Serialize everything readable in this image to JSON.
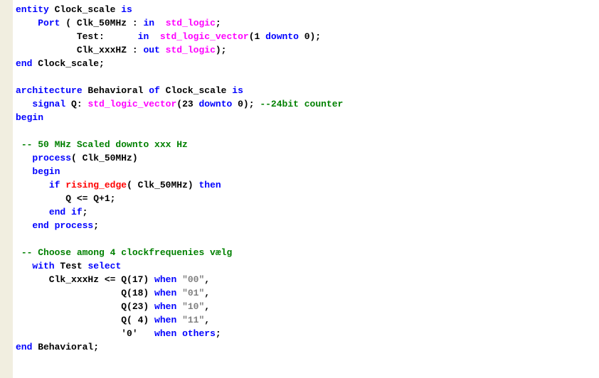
{
  "lines": [
    {
      "segments": [
        {
          "t": "entity",
          "c": "kw"
        },
        {
          "t": " Clock_scale "
        },
        {
          "t": "is",
          "c": "kw"
        }
      ]
    },
    {
      "segments": [
        {
          "t": "    "
        },
        {
          "t": "Port",
          "c": "kw"
        },
        {
          "t": " ( Clk_50MHz : "
        },
        {
          "t": "in",
          "c": "kw"
        },
        {
          "t": "  "
        },
        {
          "t": "std_logic",
          "c": "type"
        },
        {
          "t": ";"
        }
      ]
    },
    {
      "segments": [
        {
          "t": "           Test:      "
        },
        {
          "t": "in",
          "c": "kw"
        },
        {
          "t": "  "
        },
        {
          "t": "std_logic_vector",
          "c": "type"
        },
        {
          "t": "(1 "
        },
        {
          "t": "downto",
          "c": "kw"
        },
        {
          "t": " 0);"
        }
      ]
    },
    {
      "segments": [
        {
          "t": "           Clk_xxxHZ : "
        },
        {
          "t": "out",
          "c": "kw"
        },
        {
          "t": " "
        },
        {
          "t": "std_logic",
          "c": "type"
        },
        {
          "t": ");"
        }
      ]
    },
    {
      "segments": [
        {
          "t": "end",
          "c": "kw"
        },
        {
          "t": " Clock_scale;"
        }
      ]
    },
    {
      "segments": [
        {
          "t": ""
        }
      ]
    },
    {
      "segments": [
        {
          "t": "architecture",
          "c": "kw"
        },
        {
          "t": " Behavioral "
        },
        {
          "t": "of",
          "c": "kw"
        },
        {
          "t": " Clock_scale "
        },
        {
          "t": "is",
          "c": "kw"
        }
      ]
    },
    {
      "segments": [
        {
          "t": "   "
        },
        {
          "t": "signal",
          "c": "kw"
        },
        {
          "t": " Q: "
        },
        {
          "t": "std_logic_vector",
          "c": "type"
        },
        {
          "t": "(23 "
        },
        {
          "t": "downto",
          "c": "kw"
        },
        {
          "t": " 0); "
        },
        {
          "t": "--24bit counter",
          "c": "comment"
        }
      ]
    },
    {
      "segments": [
        {
          "t": "begin",
          "c": "kw"
        }
      ]
    },
    {
      "segments": [
        {
          "t": ""
        }
      ]
    },
    {
      "segments": [
        {
          "t": " "
        },
        {
          "t": "-- 50 MHz Scaled downto xxx Hz",
          "c": "comment"
        }
      ]
    },
    {
      "segments": [
        {
          "t": "   "
        },
        {
          "t": "process",
          "c": "kw"
        },
        {
          "t": "( Clk_50MHz)"
        }
      ]
    },
    {
      "segments": [
        {
          "t": "   "
        },
        {
          "t": "begin",
          "c": "kw"
        }
      ]
    },
    {
      "segments": [
        {
          "t": "      "
        },
        {
          "t": "if",
          "c": "kw"
        },
        {
          "t": " "
        },
        {
          "t": "rising_edge",
          "c": "fn"
        },
        {
          "t": "( Clk_50MHz) "
        },
        {
          "t": "then",
          "c": "kw"
        }
      ]
    },
    {
      "segments": [
        {
          "t": "         Q <= Q+1;"
        }
      ]
    },
    {
      "segments": [
        {
          "t": "      "
        },
        {
          "t": "end",
          "c": "kw"
        },
        {
          "t": " "
        },
        {
          "t": "if",
          "c": "kw"
        },
        {
          "t": ";"
        }
      ]
    },
    {
      "segments": [
        {
          "t": "   "
        },
        {
          "t": "end",
          "c": "kw"
        },
        {
          "t": " "
        },
        {
          "t": "process",
          "c": "kw"
        },
        {
          "t": ";"
        }
      ]
    },
    {
      "segments": [
        {
          "t": ""
        }
      ]
    },
    {
      "segments": [
        {
          "t": " "
        },
        {
          "t": "-- Choose among 4 clockfrequenies vælg",
          "c": "comment"
        }
      ]
    },
    {
      "segments": [
        {
          "t": "   "
        },
        {
          "t": "with",
          "c": "kw"
        },
        {
          "t": " Test "
        },
        {
          "t": "select",
          "c": "kw"
        }
      ]
    },
    {
      "segments": [
        {
          "t": "      Clk_xxxHz <= Q(17) "
        },
        {
          "t": "when",
          "c": "kw"
        },
        {
          "t": " "
        },
        {
          "t": "\"00\"",
          "c": "str"
        },
        {
          "t": ","
        }
      ]
    },
    {
      "segments": [
        {
          "t": "                   Q(18) "
        },
        {
          "t": "when",
          "c": "kw"
        },
        {
          "t": " "
        },
        {
          "t": "\"01\"",
          "c": "str"
        },
        {
          "t": ","
        }
      ]
    },
    {
      "segments": [
        {
          "t": "                   Q(23) "
        },
        {
          "t": "when",
          "c": "kw"
        },
        {
          "t": " "
        },
        {
          "t": "\"10\"",
          "c": "str"
        },
        {
          "t": ","
        }
      ]
    },
    {
      "segments": [
        {
          "t": "                   Q( 4) "
        },
        {
          "t": "when",
          "c": "kw"
        },
        {
          "t": " "
        },
        {
          "t": "\"11\"",
          "c": "str"
        },
        {
          "t": ","
        }
      ]
    },
    {
      "segments": [
        {
          "t": "                   '0'   "
        },
        {
          "t": "when",
          "c": "kw"
        },
        {
          "t": " "
        },
        {
          "t": "others",
          "c": "kw"
        },
        {
          "t": ";"
        }
      ]
    },
    {
      "segments": [
        {
          "t": "end",
          "c": "kw"
        },
        {
          "t": " Behavioral;"
        }
      ]
    }
  ]
}
